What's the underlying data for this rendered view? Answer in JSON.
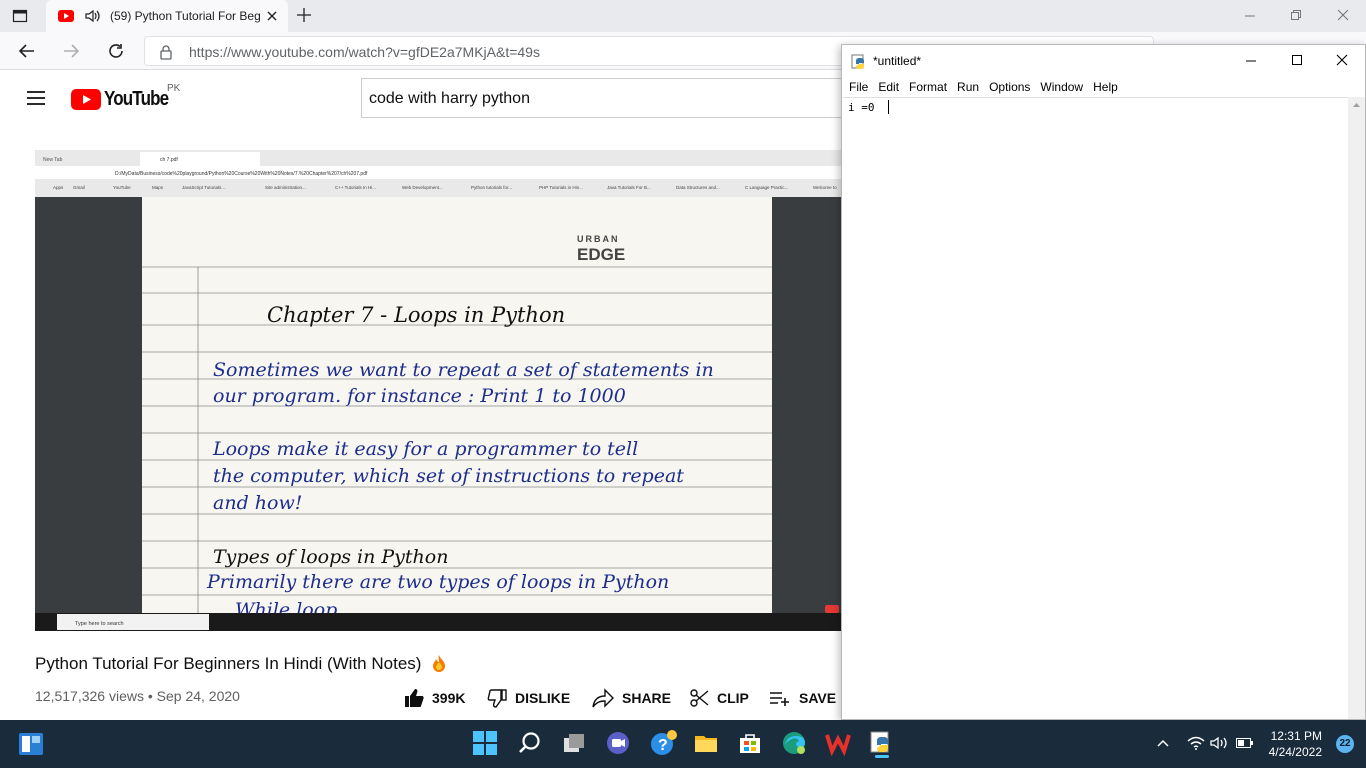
{
  "browser": {
    "tab_title": "(59) Python Tutorial For Beg",
    "url": "https://www.youtube.com/watch?v=gfDE2a7MKjA&t=49s"
  },
  "youtube": {
    "logo_text": "YouTube",
    "region": "PK",
    "search_value": "code with harry python",
    "video_title": "Python Tutorial For Beginners In Hindi (With Notes)",
    "views": "12,517,326 views",
    "date": "Sep 24, 2020",
    "meta_separator": "•",
    "actions": {
      "like": "399K",
      "dislike": "DISLIKE",
      "share": "SHARE",
      "clip": "CLIP",
      "save": "SAVE"
    }
  },
  "video": {
    "inner_tabs": [
      "New Tab",
      "ch 7.pdf"
    ],
    "inner_url": "D:/MyData/Business/code%20playground/Python%20Course%20With%20Notes/7.%20Chapter%207/ch%207.pdf",
    "bookmarks": [
      "Apps",
      "Gmail",
      "YouTube",
      "Maps",
      "JavaScript Tutorials...",
      "Site administration...",
      "C++ Tutorials In Hi...",
      "Web Development...",
      "Python tutorials for...",
      "PHP Tutorials in Hin...",
      "Java Tutorials For B...",
      "Data Structures and...",
      "C Language Practic...",
      "Welcome to"
    ],
    "brand": "URBAN",
    "brand2": "EDGE",
    "notes": {
      "heading": "Chapter 7 - Loops in Python",
      "para1": [
        "Sometimes we want to repeat a set of statements in",
        "our program. for instance : Print 1 to 1000"
      ],
      "para2": [
        "Loops make it easy for a programmer to tell",
        "the computer, which set of instructions to repeat",
        "and how!"
      ],
      "subheading": "Types of loops in Python",
      "para3": "Primarily there are two types of loops in Python",
      "cut_line": "While loop"
    },
    "inner_taskbar_search": "Type here to search"
  },
  "idle": {
    "title": "*untitled*",
    "menu": [
      "File",
      "Edit",
      "Format",
      "Run",
      "Options",
      "Window",
      "Help"
    ],
    "code": "i =0"
  },
  "taskbar": {
    "time": "12:31 PM",
    "date": "4/24/2022",
    "notifications": "22"
  },
  "colors": {
    "youtube_red": "#ff0000",
    "taskbar_bg": "#1a2b3c",
    "ink": "#1d2d8c"
  }
}
